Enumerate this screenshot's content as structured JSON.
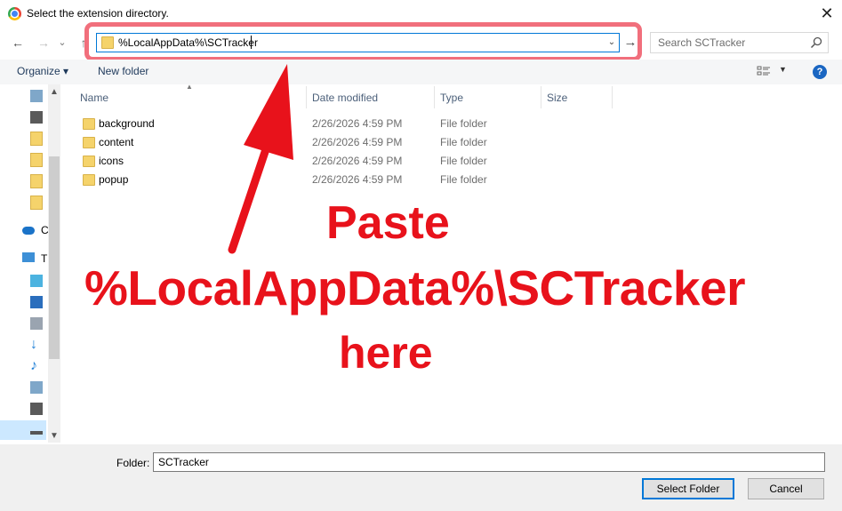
{
  "window": {
    "title": "Select the extension directory.",
    "close_glyph": "✕"
  },
  "nav": {
    "back_glyph": "←",
    "forward_glyph": "→",
    "recent_glyph": "⌄",
    "up_glyph": "↑",
    "address_value": "%LocalAppData%\\SCTracker",
    "address_dropdown_glyph": "⌄",
    "go_glyph": "→",
    "search_placeholder": "Search SCTracker"
  },
  "toolbar": {
    "organize_label": "Organize ▾",
    "new_folder_label": "New folder",
    "view_dropdown_glyph": "▼",
    "help_label": "?"
  },
  "navpane": {
    "items": [
      {
        "icon": "pictures-icon"
      },
      {
        "icon": "video-icon"
      },
      {
        "icon": "folder-icon"
      },
      {
        "icon": "folder-icon"
      },
      {
        "icon": "folder-icon"
      },
      {
        "icon": "folder-icon"
      },
      {
        "icon": "onedrive-icon",
        "label": "C"
      },
      {
        "icon": "this-pc-icon",
        "label": "T"
      },
      {
        "icon": "3d-objects-icon"
      },
      {
        "icon": "desktop-icon"
      },
      {
        "icon": "documents-icon"
      },
      {
        "icon": "downloads-icon"
      },
      {
        "icon": "music-icon"
      },
      {
        "icon": "pictures-icon"
      },
      {
        "icon": "videos-icon"
      },
      {
        "icon": "drive-icon"
      }
    ]
  },
  "columns": [
    "Name",
    "Date modified",
    "Type",
    "Size"
  ],
  "files": [
    {
      "name": "background",
      "date": "2/26/2026 4:59 PM",
      "type": "File folder"
    },
    {
      "name": "content",
      "date": "2/26/2026 4:59 PM",
      "type": "File folder"
    },
    {
      "name": "icons",
      "date": "2/26/2026 4:59 PM",
      "type": "File folder"
    },
    {
      "name": "popup",
      "date": "2/26/2026 4:59 PM",
      "type": "File folder"
    }
  ],
  "annotation": {
    "line1": "Paste",
    "line2": "%LocalAppData%\\SCTracker",
    "line3": "here",
    "color": "#e8121b",
    "highlight_color": "#f16f7c"
  },
  "footer": {
    "folder_label": "Folder:",
    "folder_value": "SCTracker",
    "select_button": "Select Folder",
    "cancel_button": "Cancel"
  }
}
